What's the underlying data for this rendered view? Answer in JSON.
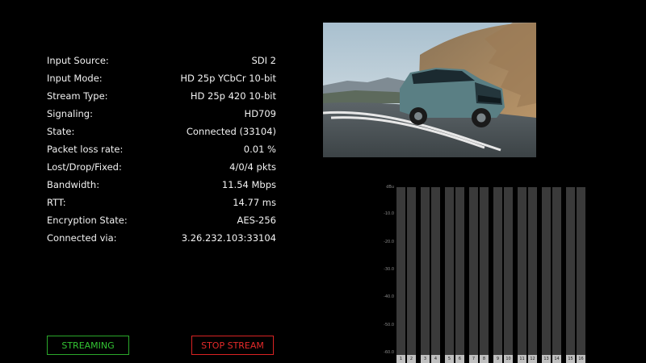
{
  "stats": [
    {
      "label": "Input Source:",
      "value": "SDI 2"
    },
    {
      "label": "Input Mode:",
      "value": "HD 25p YCbCr 10-bit"
    },
    {
      "label": "Stream Type:",
      "value": "HD 25p 420 10-bit"
    },
    {
      "label": "Signaling:",
      "value": "HD709"
    },
    {
      "label": "State:",
      "value": "Connected (33104)"
    },
    {
      "label": "Packet loss rate:",
      "value": "0.01 %"
    },
    {
      "label": "Lost/Drop/Fixed:",
      "value": "4/0/4 pkts"
    },
    {
      "label": "Bandwidth:",
      "value": "11.54 Mbps"
    },
    {
      "label": "RTT:",
      "value": "14.77 ms"
    },
    {
      "label": "Encryption State:",
      "value": "AES-256"
    },
    {
      "label": "Connected via:",
      "value": "3.26.232.103:33104"
    }
  ],
  "buttons": {
    "streaming": "STREAMING",
    "stop": "STOP STREAM"
  },
  "audio_meter": {
    "scale": [
      "dBu",
      "-10.0",
      "-20.0",
      "-30.0",
      "-40.0",
      "-50.0",
      "-60.0"
    ],
    "channels": [
      "1",
      "2",
      "3",
      "4",
      "5",
      "6",
      "7",
      "8",
      "9",
      "10",
      "11",
      "12",
      "13",
      "14",
      "15",
      "16"
    ]
  },
  "preview": {
    "icon": "video-preview-car-on-road"
  },
  "colors": {
    "background": "#000000",
    "streaming": "#33c433",
    "stop": "#e52a2a",
    "meter_bar": "#3a3a3a"
  }
}
